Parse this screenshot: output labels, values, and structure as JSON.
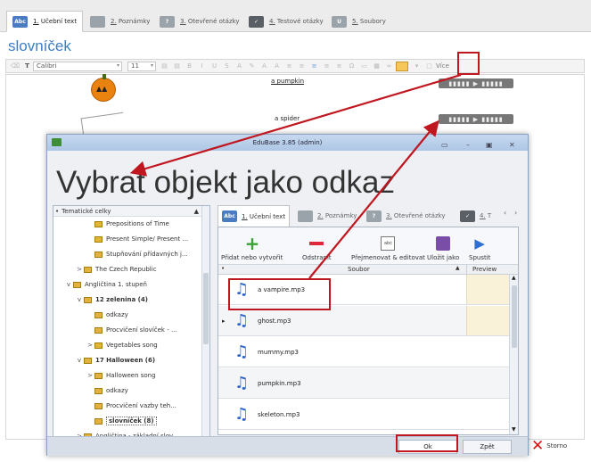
{
  "tabs": [
    {
      "icon": "text-icon",
      "iconText": "Abc",
      "num": "1.",
      "label": "Učební text",
      "active": true
    },
    {
      "icon": "notes-icon",
      "iconText": "",
      "num": "2.",
      "label": "Poznámky"
    },
    {
      "icon": "question-icon",
      "iconText": "?",
      "num": "3.",
      "label": "Otevřené otázky"
    },
    {
      "icon": "check-icon",
      "iconText": "✓",
      "num": "4.",
      "label": "Testové otázky"
    },
    {
      "icon": "attachment-icon",
      "iconText": "U",
      "num": "5.",
      "label": "Soubory"
    }
  ],
  "document": {
    "title": "slovníček",
    "font": "Calibri",
    "size": "11",
    "more_label": "Více"
  },
  "words": [
    "a pumpkin",
    "a spider"
  ],
  "dialog": {
    "window_title": "EduBase 3.85 (admin)",
    "heading": "Vybrat objekt jako odkaz",
    "tree_header": "Tematické celky",
    "tree": [
      {
        "label": "Prepositions of Time",
        "indent": 3,
        "arrow": ""
      },
      {
        "label": "Present Simple/ Present ...",
        "indent": 3,
        "arrow": ""
      },
      {
        "label": "Stupňování přídavných j...",
        "indent": 3,
        "arrow": ""
      },
      {
        "label": "The Czech Republic",
        "indent": 2,
        "arrow": ">"
      },
      {
        "label": "Angličtina 1. stupeň",
        "indent": 1,
        "arrow": "v"
      },
      {
        "label": "12 zelenina (4)",
        "indent": 2,
        "arrow": "v",
        "bold": true
      },
      {
        "label": "odkazy",
        "indent": 3,
        "arrow": ""
      },
      {
        "label": "Procvičení slovíček - ...",
        "indent": 3,
        "arrow": ""
      },
      {
        "label": "Vegetables song",
        "indent": 3,
        "arrow": ">"
      },
      {
        "label": "17 Halloween (6)",
        "indent": 2,
        "arrow": "v",
        "bold": true
      },
      {
        "label": "Halloween song",
        "indent": 3,
        "arrow": ">"
      },
      {
        "label": "odkazy",
        "indent": 3,
        "arrow": ""
      },
      {
        "label": "Procvičení vazby teh...",
        "indent": 3,
        "arrow": ""
      },
      {
        "label": "slovníček (8)",
        "indent": 3,
        "arrow": "",
        "selected": true
      },
      {
        "label": "Angličtina - základní slov...",
        "indent": 2,
        "arrow": ">"
      }
    ],
    "inner_tabs": [
      {
        "iconText": "Abc",
        "num": "1.",
        "label": "Učební text"
      },
      {
        "iconText": "",
        "num": "2.",
        "label": "Poznámky"
      },
      {
        "iconText": "?",
        "num": "3.",
        "label": "Otevřené otázky"
      },
      {
        "iconText": "✓",
        "num": "4.",
        "label": "T"
      }
    ],
    "ribbon": [
      "Přidat nebo vytvořit",
      "Odstranit",
      "Přejmenovat & editovat",
      "Uložit jako",
      "Spustit"
    ],
    "grid_headers": {
      "file": "Soubor",
      "preview": "Preview"
    },
    "files": [
      "a vampire.mp3",
      "ghost.mp3",
      "mummy.mp3",
      "pumpkin.mp3",
      "skeleton.mp3"
    ],
    "ok": "Ok",
    "back": "Zpět"
  },
  "storno": "Storno"
}
